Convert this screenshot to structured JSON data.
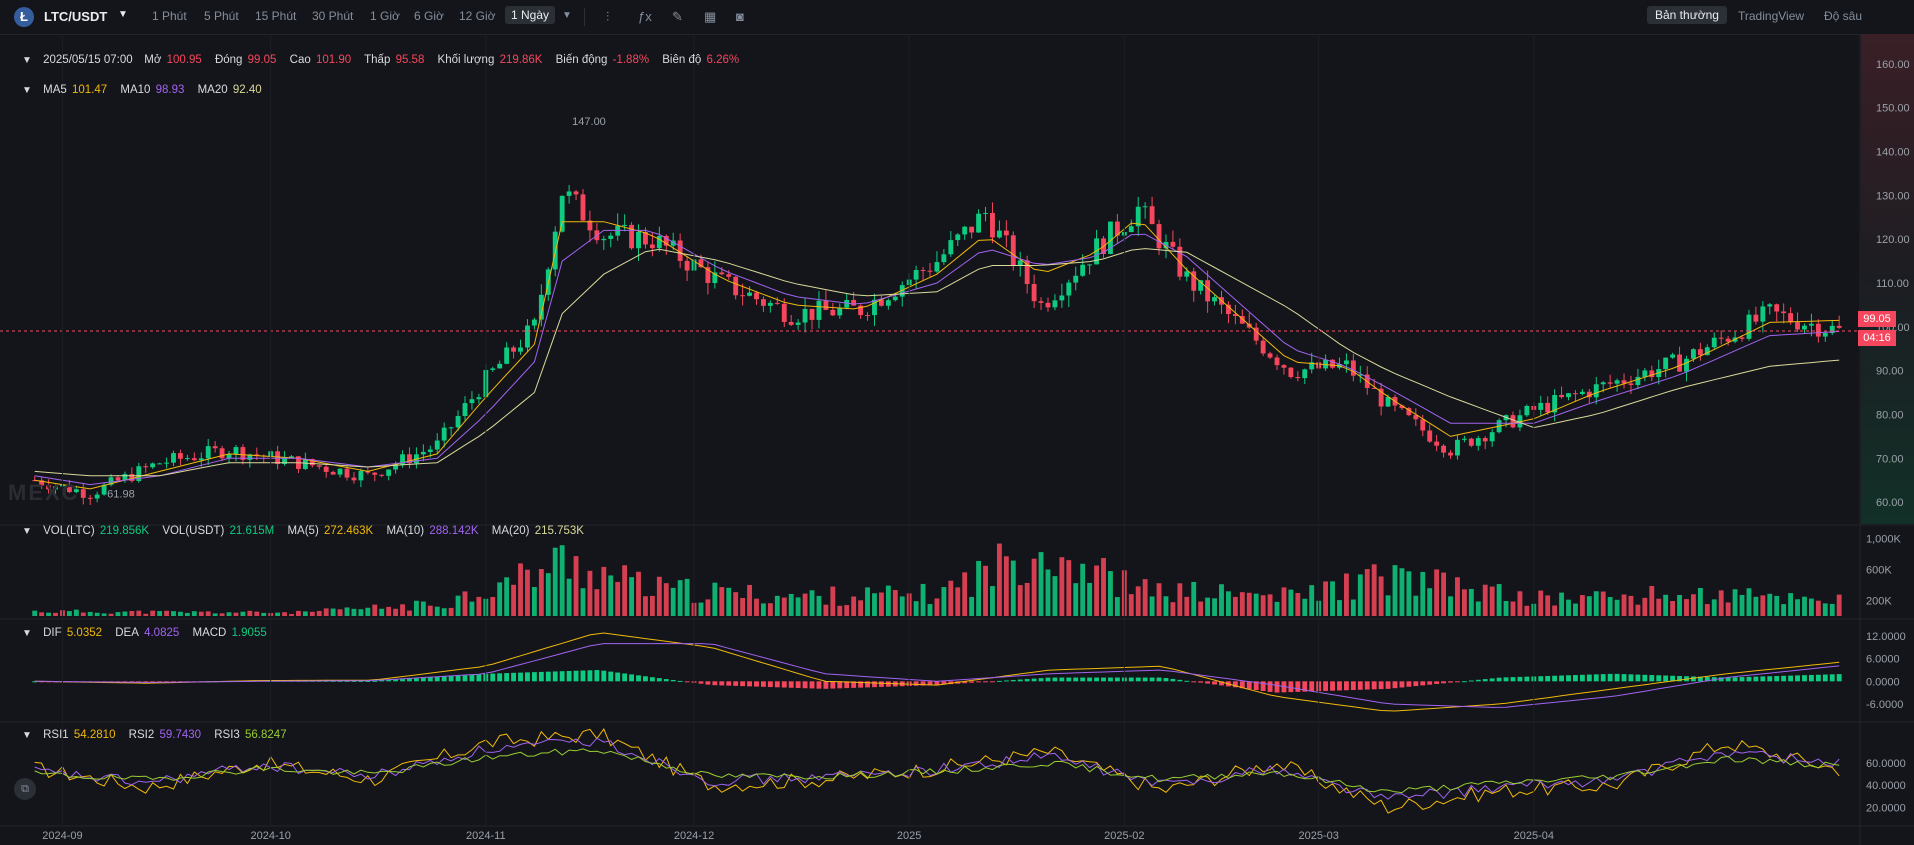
{
  "header": {
    "logo_letter": "Ł",
    "symbol": "LTC/USDT",
    "timeframes": [
      "1 Phút",
      "5 Phút",
      "15 Phút",
      "30 Phút",
      "1 Giờ",
      "6 Giờ",
      "12 Giờ",
      "1 Ngày"
    ],
    "active_timeframe": "1 Ngày",
    "modes": [
      "Bản thường",
      "TradingView",
      "Độ sâu"
    ],
    "active_mode": "Bản thường"
  },
  "ohlc": {
    "date": "2025/05/15 07:00",
    "open_label": "Mở",
    "open": "100.95",
    "close_label": "Đóng",
    "close": "99.05",
    "high_label": "Cao",
    "high": "101.90",
    "low_label": "Thấp",
    "low": "95.58",
    "volume_label": "Khối lượng",
    "volume": "219.86K",
    "change_label": "Biến động",
    "change": "-1.88%",
    "amplitude_label": "Biên độ",
    "amplitude": "6.26%"
  },
  "ma_legend": {
    "ma5_label": "MA5",
    "ma5": "101.47",
    "ma10_label": "MA10",
    "ma10": "98.93",
    "ma20_label": "MA20",
    "ma20": "92.40"
  },
  "vol_legend": {
    "vol_ltc_label": "VOL(LTC)",
    "vol_ltc": "219.856K",
    "vol_usdt_label": "VOL(USDT)",
    "vol_usdt": "21.615M",
    "ma5_label": "MA(5)",
    "ma5": "272.463K",
    "ma10_label": "MA(10)",
    "ma10": "288.142K",
    "ma20_label": "MA(20)",
    "ma20": "215.753K"
  },
  "macd_legend": {
    "dif_label": "DIF",
    "dif": "5.0352",
    "dea_label": "DEA",
    "dea": "4.0825",
    "macd_label": "MACD",
    "macd": "1.9055"
  },
  "rsi_legend": {
    "rsi1_label": "RSI1",
    "rsi1": "54.2810",
    "rsi2_label": "RSI2",
    "rsi2": "59.7430",
    "rsi3_label": "RSI3",
    "rsi3": "56.8247"
  },
  "price_badge": {
    "price": "99.05",
    "countdown": "04:16"
  },
  "watermark": "MEXC",
  "colors": {
    "up": "#0ecb81",
    "down": "#f6465d",
    "ma5": "#f0b90b",
    "ma10": "#a064f0",
    "ma20": "#d9d99a",
    "background": "#14151a"
  },
  "chart_data": [
    {
      "type": "candlestick",
      "title": "LTC/USDT 1 Ngày",
      "ylim": [
        55,
        165
      ],
      "y_ticks": [
        "160.00",
        "150.00",
        "140.00",
        "130.00",
        "120.00",
        "110.00",
        "100.00",
        "90.00",
        "80.00",
        "70.00",
        "60.00"
      ],
      "x_ticks": [
        "2024-09",
        "2024-10",
        "2024-11",
        "2024-12",
        "2025",
        "2025-02",
        "2025-03",
        "2025-04"
      ],
      "annotations": [
        {
          "text": "147.00",
          "x": "2024-11-12",
          "y": 147.0
        },
        {
          "text": "61.98",
          "x": "2024-09-06",
          "y": 61.98
        }
      ],
      "current_price": 99.05,
      "series": [
        {
          "name": "Price path (close, sampled)",
          "x": [
            "2024-08-28",
            "2024-09-05",
            "2024-09-15",
            "2024-09-25",
            "2024-10-05",
            "2024-10-15",
            "2024-10-25",
            "2024-11-01",
            "2024-11-08",
            "2024-11-12",
            "2024-11-18",
            "2024-11-25",
            "2024-12-05",
            "2024-12-15",
            "2024-12-25",
            "2025-01-05",
            "2025-01-12",
            "2025-01-20",
            "2025-01-28",
            "2025-02-03",
            "2025-02-10",
            "2025-02-25",
            "2025-03-05",
            "2025-03-11",
            "2025-03-20",
            "2025-04-01",
            "2025-04-10",
            "2025-04-22",
            "2025-05-05",
            "2025-05-15"
          ],
          "values": [
            65,
            62,
            69,
            72,
            69,
            66,
            73,
            88,
            100,
            131,
            121,
            120,
            110,
            103,
            104,
            115,
            126,
            105,
            118,
            127,
            111,
            90,
            91,
            82,
            72,
            81,
            86,
            92,
            103,
            99.05
          ]
        },
        {
          "name": "MA5",
          "values": [
            65,
            63,
            67,
            71,
            70,
            67,
            71,
            84,
            96,
            124,
            124,
            121,
            111,
            105,
            104,
            112,
            121,
            112,
            117,
            125,
            113,
            92,
            91,
            84,
            75,
            79,
            85,
            91,
            101,
            101.47
          ]
        },
        {
          "name": "MA10",
          "values": [
            66,
            64,
            66,
            70,
            70,
            68,
            70,
            80,
            92,
            115,
            122,
            122,
            113,
            107,
            105,
            110,
            118,
            114,
            116,
            122,
            116,
            95,
            91,
            86,
            78,
            78,
            83,
            89,
            98,
            98.93
          ]
        },
        {
          "name": "MA20",
          "values": [
            67,
            66,
            66,
            69,
            69,
            68,
            69,
            76,
            85,
            103,
            112,
            118,
            115,
            110,
            107,
            108,
            114,
            114,
            115,
            118,
            117,
            104,
            95,
            90,
            84,
            77,
            80,
            86,
            91,
            92.4
          ]
        }
      ]
    },
    {
      "type": "bar",
      "title": "VOL(LTC)",
      "y_ticks": [
        "1,000K",
        "600K",
        "200K"
      ],
      "x": [
        "2024-08-28",
        "2024-09-15",
        "2024-10-05",
        "2024-10-25",
        "2024-11-05",
        "2024-11-12",
        "2024-11-25",
        "2024-12-15",
        "2025-01-05",
        "2025-01-20",
        "2025-02-03",
        "2025-02-25",
        "2025-03-11",
        "2025-04-01",
        "2025-04-22",
        "2025-05-15"
      ],
      "values": [
        60,
        50,
        45,
        150,
        450,
        700,
        350,
        250,
        280,
        900,
        330,
        250,
        500,
        220,
        270,
        219.856
      ]
    },
    {
      "type": "bar",
      "title": "MACD",
      "y_ticks": [
        "12.0000",
        "6.0000",
        "0.0000",
        "-6.0000"
      ],
      "series": [
        {
          "name": "DIF",
          "values": [
            0,
            -0.5,
            0.2,
            0.3,
            4,
            13,
            9,
            0,
            -1,
            3,
            4,
            -4,
            -8,
            -6,
            -2,
            2,
            5.0352
          ]
        },
        {
          "name": "DEA",
          "values": [
            0,
            -0.3,
            0,
            0.2,
            2,
            10,
            10,
            2,
            0,
            2,
            3,
            -1,
            -6,
            -7,
            -4,
            1,
            4.0825
          ]
        },
        {
          "name": "MACD",
          "values": [
            0,
            -0.2,
            0.2,
            0.1,
            2,
            3,
            -1,
            -2,
            -1,
            1,
            1,
            -3,
            -2,
            1,
            2,
            1,
            1.9055
          ]
        }
      ]
    },
    {
      "type": "line",
      "title": "RSI",
      "y_ticks": [
        "60.0000",
        "40.0000",
        "20.0000"
      ],
      "series": [
        {
          "name": "RSI1",
          "values": [
            55,
            38,
            60,
            45,
            78,
            86,
            40,
            45,
            55,
            70,
            35,
            60,
            20,
            35,
            40,
            78,
            54.281
          ]
        },
        {
          "name": "RSI2",
          "values": [
            52,
            42,
            58,
            48,
            72,
            80,
            44,
            47,
            54,
            66,
            40,
            55,
            28,
            38,
            45,
            70,
            59.743
          ]
        },
        {
          "name": "RSI3",
          "values": [
            50,
            45,
            55,
            50,
            65,
            72,
            48,
            48,
            52,
            60,
            45,
            52,
            34,
            42,
            48,
            64,
            56.8247
          ]
        }
      ]
    }
  ]
}
